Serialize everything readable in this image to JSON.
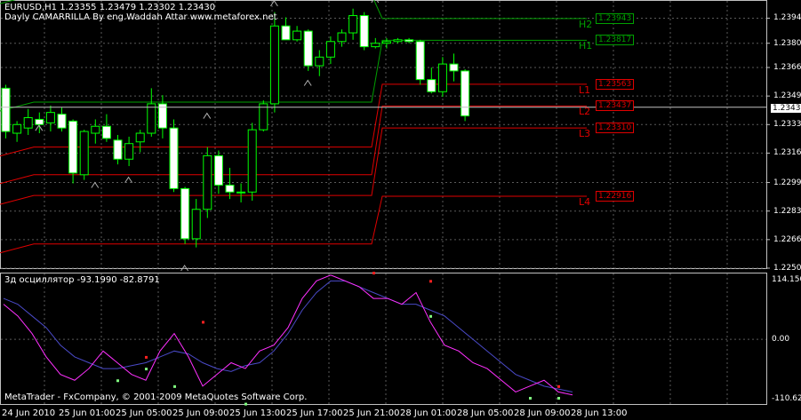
{
  "header": {
    "symbol_line": "EURUSD,H1  1.23355 1.23479 1.23302 1.23430",
    "indicator_line": "Dayly CAMARRILLA By eng.Waddah Attar  www.metaforex.net"
  },
  "subwindow": {
    "title": "3д осциллятор -93.1990 -82.8791",
    "copyright": "MetaTrader - FxCompany, © 2001-2009 MetaQuotes Software Corp.",
    "scale_top": "114.1500",
    "scale_mid": "0.00",
    "scale_bottom": "-110.6250"
  },
  "price_axis": {
    "labels": [
      "1.23945",
      "1.23800",
      "1.23660",
      "1.23495",
      "1.23330",
      "1.23165",
      "1.22995",
      "1.22830",
      "1.22665",
      "1.22500"
    ],
    "current": "1.23430"
  },
  "time_axis": {
    "labels": [
      "24 Jun 2010",
      "25 Jun 01:00",
      "25 Jun 05:00",
      "25 Jun 09:00",
      "25 Jun 13:00",
      "25 Jun 17:00",
      "25 Jun 21:00",
      "28 Jun 01:00",
      "28 Jun 05:00",
      "28 Jun 09:00",
      "28 Jun 13:00"
    ]
  },
  "levels": [
    {
      "name": "H2",
      "value": "1.23943",
      "color": "#00a000"
    },
    {
      "name": "H1",
      "value": "1.23817",
      "color": "#00a000"
    },
    {
      "name": "L1",
      "value": "1.23563",
      "color": "#e00000"
    },
    {
      "name": "L2",
      "value": "1.23437",
      "color": "#e00000"
    },
    {
      "name": "L3",
      "value": "1.23310",
      "color": "#e00000"
    },
    {
      "name": "L4",
      "value": "1.22916",
      "color": "#e00000"
    }
  ],
  "colors": {
    "background": "#000000",
    "bull_candle": "#000000",
    "bear_candle": "#ffffff",
    "grid": "#5a5a5a",
    "resistance": "#00a000",
    "support": "#e00000",
    "osc_fast": "#ff30ff",
    "osc_slow": "#4a4ac8"
  },
  "chart_data": {
    "type": "candlestick",
    "series": [
      {
        "name": "EURUSD,H1",
        "ohlc": [
          [
            1.2354,
            1.2356,
            1.2325,
            1.2329
          ],
          [
            1.2328,
            1.2335,
            1.2323,
            1.2333
          ],
          [
            1.2331,
            1.2342,
            1.2327,
            1.2337
          ],
          [
            1.2336,
            1.234,
            1.2328,
            1.2333
          ],
          [
            1.2334,
            1.2344,
            1.2329,
            1.234
          ],
          [
            1.2339,
            1.2343,
            1.2329,
            1.2331
          ],
          [
            1.2335,
            1.2336,
            1.2299,
            1.2305
          ],
          [
            1.2304,
            1.233,
            1.2301,
            1.2329
          ],
          [
            1.2328,
            1.2336,
            1.2322,
            1.2332
          ],
          [
            1.2332,
            1.2339,
            1.2323,
            1.2325
          ],
          [
            1.2324,
            1.2327,
            1.231,
            1.2313
          ],
          [
            1.2313,
            1.2326,
            1.2309,
            1.2322
          ],
          [
            1.2323,
            1.233,
            1.2317,
            1.2328
          ],
          [
            1.2328,
            1.2354,
            1.2326,
            1.2345
          ],
          [
            1.2345,
            1.235,
            1.2325,
            1.2331
          ],
          [
            1.2331,
            1.2336,
            1.2294,
            1.2296
          ],
          [
            1.2296,
            1.2297,
            1.2264,
            1.2267
          ],
          [
            1.2267,
            1.229,
            1.2262,
            1.2284
          ],
          [
            1.2284,
            1.232,
            1.2279,
            1.2315
          ],
          [
            1.2315,
            1.2318,
            1.2293,
            1.2298
          ],
          [
            1.2298,
            1.2308,
            1.229,
            1.2294
          ],
          [
            1.2294,
            1.2299,
            1.2288,
            1.2294
          ],
          [
            1.2294,
            1.2334,
            1.2289,
            1.233
          ],
          [
            1.233,
            1.2347,
            1.2329,
            1.2345
          ],
          [
            1.2345,
            1.2398,
            1.234,
            1.239
          ],
          [
            1.239,
            1.2395,
            1.2382,
            1.2382
          ],
          [
            1.2382,
            1.239,
            1.2381,
            1.2387
          ],
          [
            1.2387,
            1.2388,
            1.2364,
            1.2367
          ],
          [
            1.2367,
            1.2376,
            1.2361,
            1.2372
          ],
          [
            1.2372,
            1.2384,
            1.2368,
            1.2381
          ],
          [
            1.2381,
            1.2388,
            1.2378,
            1.2386
          ],
          [
            1.2386,
            1.24,
            1.2382,
            1.2396
          ],
          [
            1.2396,
            1.2398,
            1.2376,
            1.2378
          ],
          [
            1.2378,
            1.2383,
            1.2377,
            1.238
          ],
          [
            1.238,
            1.2383,
            1.2377,
            1.2381
          ],
          [
            1.2381,
            1.2383,
            1.238,
            1.2382
          ],
          [
            1.2382,
            1.2383,
            1.238,
            1.2381
          ],
          [
            1.2381,
            1.2382,
            1.2356,
            1.2359
          ],
          [
            1.2359,
            1.2366,
            1.2351,
            1.2352
          ],
          [
            1.2352,
            1.2372,
            1.2349,
            1.2368
          ],
          [
            1.2368,
            1.2374,
            1.2358,
            1.2364
          ],
          [
            1.2364,
            1.2365,
            1.2335,
            1.2338
          ]
        ]
      }
    ],
    "oscillator": {
      "fast": [
        60,
        40,
        10,
        -30,
        -60,
        -70,
        -50,
        -20,
        -40,
        -60,
        -70,
        -20,
        10,
        -30,
        -80,
        -60,
        -40,
        -50,
        -20,
        -10,
        20,
        70,
        100,
        110,
        100,
        90,
        70,
        70,
        60,
        80,
        30,
        -10,
        -20,
        -40,
        -50,
        -70,
        -90,
        -80,
        -70,
        -90,
        -95
      ],
      "slow": [
        70,
        60,
        40,
        20,
        -10,
        -30,
        -40,
        -50,
        -50,
        -45,
        -40,
        -30,
        -20,
        -25,
        -40,
        -50,
        -55,
        -45,
        -40,
        -20,
        10,
        50,
        80,
        100,
        100,
        90,
        80,
        70,
        60,
        60,
        50,
        40,
        20,
        0,
        -20,
        -40,
        -60,
        -70,
        -80,
        -85,
        -90
      ],
      "ylim": [
        -110.625,
        114.15
      ]
    },
    "ylim": [
      1.225,
      1.2405
    ]
  }
}
